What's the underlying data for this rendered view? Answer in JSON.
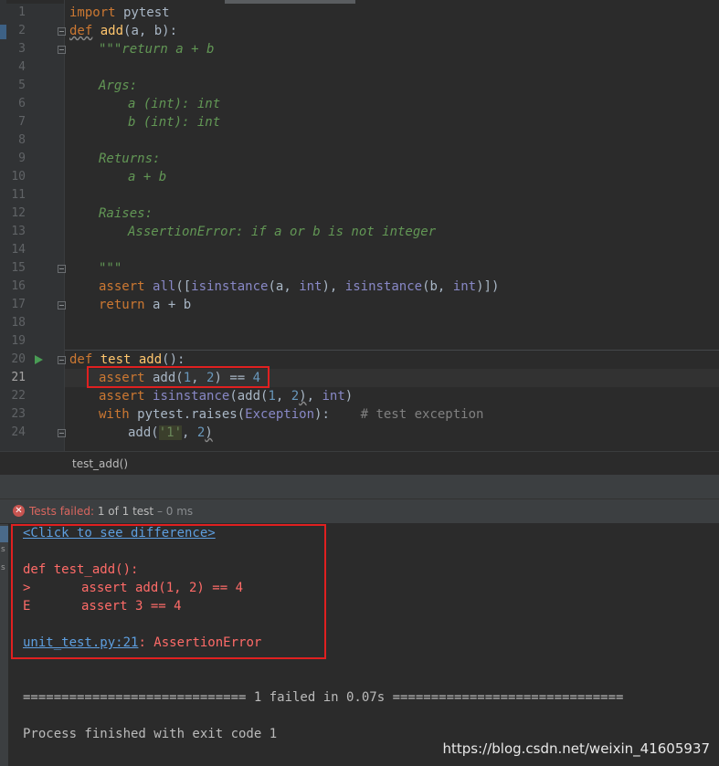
{
  "editor": {
    "line_numbers": [
      "1",
      "2",
      "3",
      "4",
      "5",
      "6",
      "7",
      "8",
      "9",
      "10",
      "11",
      "12",
      "13",
      "14",
      "15",
      "16",
      "17",
      "18",
      "19",
      "20",
      "21",
      "22",
      "23",
      "24"
    ],
    "code": {
      "l1_import": "import",
      "l1_module": " pytest",
      "l2_def": "def",
      "l2_name": "add",
      "l2_params": "(a, b):",
      "l3": "\"\"\"return a + b",
      "l5": "Args:",
      "l6": "a (int): int",
      "l7": "b (int): int",
      "l9": "Returns:",
      "l10": "a + b",
      "l12": "Raises:",
      "l13": "AssertionError: if a or b is not integer",
      "l15": "\"\"\"",
      "l16_assert": "assert",
      "l16_all": "all",
      "l16_open": "([",
      "l16_isinstance1": "isinstance",
      "l16_args1": "(a, ",
      "l16_int1": "int",
      "l16_mid": "), ",
      "l16_isinstance2": "isinstance",
      "l16_args2": "(b, ",
      "l16_int2": "int",
      "l16_close": ")])",
      "l17_return": "return",
      "l17_expr": " a + b",
      "l20_def": "def",
      "l20_name": "test_add",
      "l20_params": "():",
      "l21_assert": "assert",
      "l21_call": " add(",
      "l21_n1": "1",
      "l21_comma": ", ",
      "l21_n2": "2",
      "l21_eq": ") == ",
      "l21_n4": "4",
      "l22_assert": "assert",
      "l22_isinstance": "isinstance",
      "l22_call": "(add(",
      "l22_n1": "1",
      "l22_comma": ", ",
      "l22_n2": "2",
      "l22_close": ")",
      "l22_comma2": ", ",
      "l22_int": "int",
      "l22_end": ")",
      "l23_with": "with",
      "l23_raises": " pytest.raises(",
      "l23_exc": "Exception",
      "l23_close": "):",
      "l23_comment": "# test exception",
      "l24_call": "add(",
      "l24_str": "'1'",
      "l24_comma": ", ",
      "l24_n2": "2",
      "l24_close": ")"
    }
  },
  "breadcrumb": {
    "function": "test_add()"
  },
  "run_panel": {
    "status_prefix": "Tests failed: ",
    "status_count": "1 of 1 test",
    "status_time": " – 0 ms",
    "console": {
      "diff_link": "<Click to see difference>",
      "def_line": "def test_add():",
      "gt_marker": ">",
      "gt_code": "assert add(1, 2) == 4",
      "e_marker": "E",
      "e_code": "assert 3 == 4",
      "file_link": "unit_test.py:21",
      "error_suffix": ": AssertionError",
      "summary": "============================= 1 failed in 0.07s ==============================",
      "process": "Process finished with exit code 1"
    }
  },
  "watermark": "https://blog.csdn.net/weixin_41605937",
  "colors": {
    "keyword": "#cc7832",
    "function": "#ffc66d",
    "number": "#6897bb",
    "docstring": "#629755",
    "builtin": "#8888c6",
    "error_text": "#ff6b68",
    "link": "#5e9fe0",
    "highlight_border": "#e02020"
  }
}
